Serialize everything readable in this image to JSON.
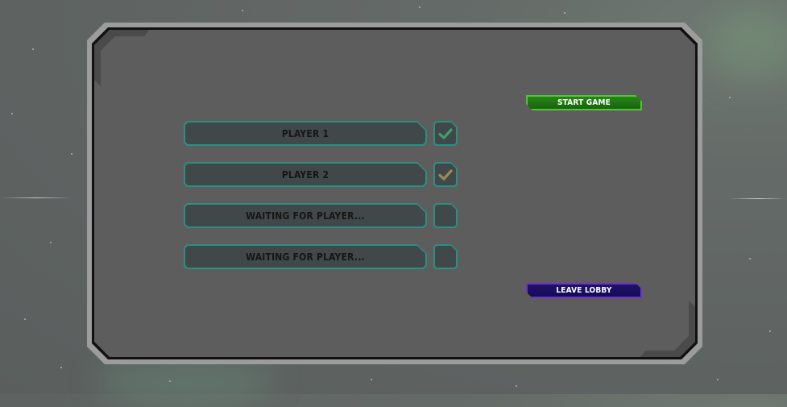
{
  "lobby": {
    "slots": [
      {
        "label": "PLAYER 1",
        "ready": true,
        "check_color": "#3f9e6e"
      },
      {
        "label": "PLAYER 2",
        "ready": true,
        "check_color": "#9a8a5a"
      },
      {
        "label": "WAITING FOR PLAYER...",
        "ready": false
      },
      {
        "label": "WAITING FOR PLAYER...",
        "ready": false
      }
    ],
    "start_button": {
      "label": "START GAME",
      "color": "#1e7a12"
    },
    "leave_button": {
      "label": "LEAVE LOBBY",
      "color": "#1a0e5e"
    }
  },
  "icons": {
    "ready": "checkmark-icon"
  }
}
